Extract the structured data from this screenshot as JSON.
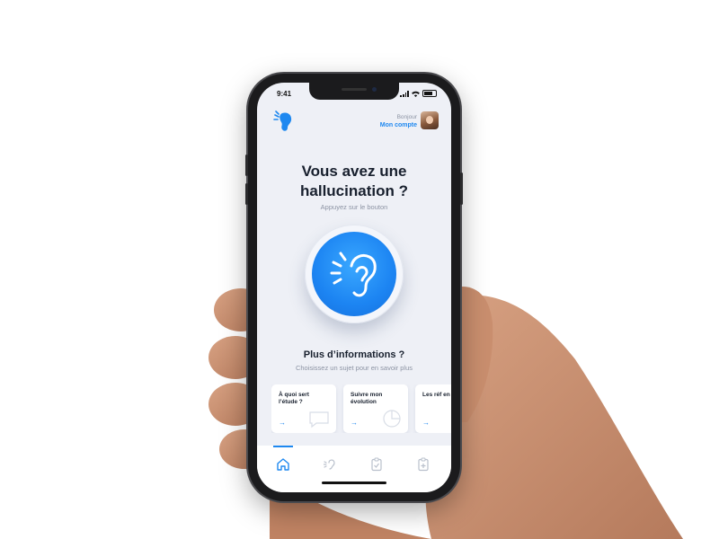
{
  "status_bar": {
    "time": "9:41"
  },
  "header": {
    "greeting": "Bonjour",
    "account_link": "Mon compte"
  },
  "hero": {
    "title_line1": "Vous avez une",
    "title_line2": "hallucination ?",
    "subtitle": "Appuyez sur le bouton"
  },
  "info": {
    "title": "Plus d’informations ?",
    "subtitle": "Choisissez un sujet pour en savoir plus"
  },
  "cards": [
    {
      "label": "À quoi sert l’étude ?",
      "arrow": "→",
      "icon": "speech-bubble-icon"
    },
    {
      "label": "Suivre mon évolution",
      "arrow": "→",
      "icon": "pie-chart-icon"
    },
    {
      "label": "Les réf en cas",
      "arrow": "→",
      "icon": ""
    }
  ],
  "tabbar": {
    "tabs": [
      {
        "icon": "home-icon",
        "active": true
      },
      {
        "icon": "ear-icon",
        "active": false
      },
      {
        "icon": "clipboard-icon",
        "active": false
      },
      {
        "icon": "medical-clipboard-icon",
        "active": false
      }
    ]
  },
  "colors": {
    "accent": "#1e88f0",
    "screen_bg": "#eef0f6",
    "title": "#18202e",
    "muted": "#8c93a3"
  }
}
